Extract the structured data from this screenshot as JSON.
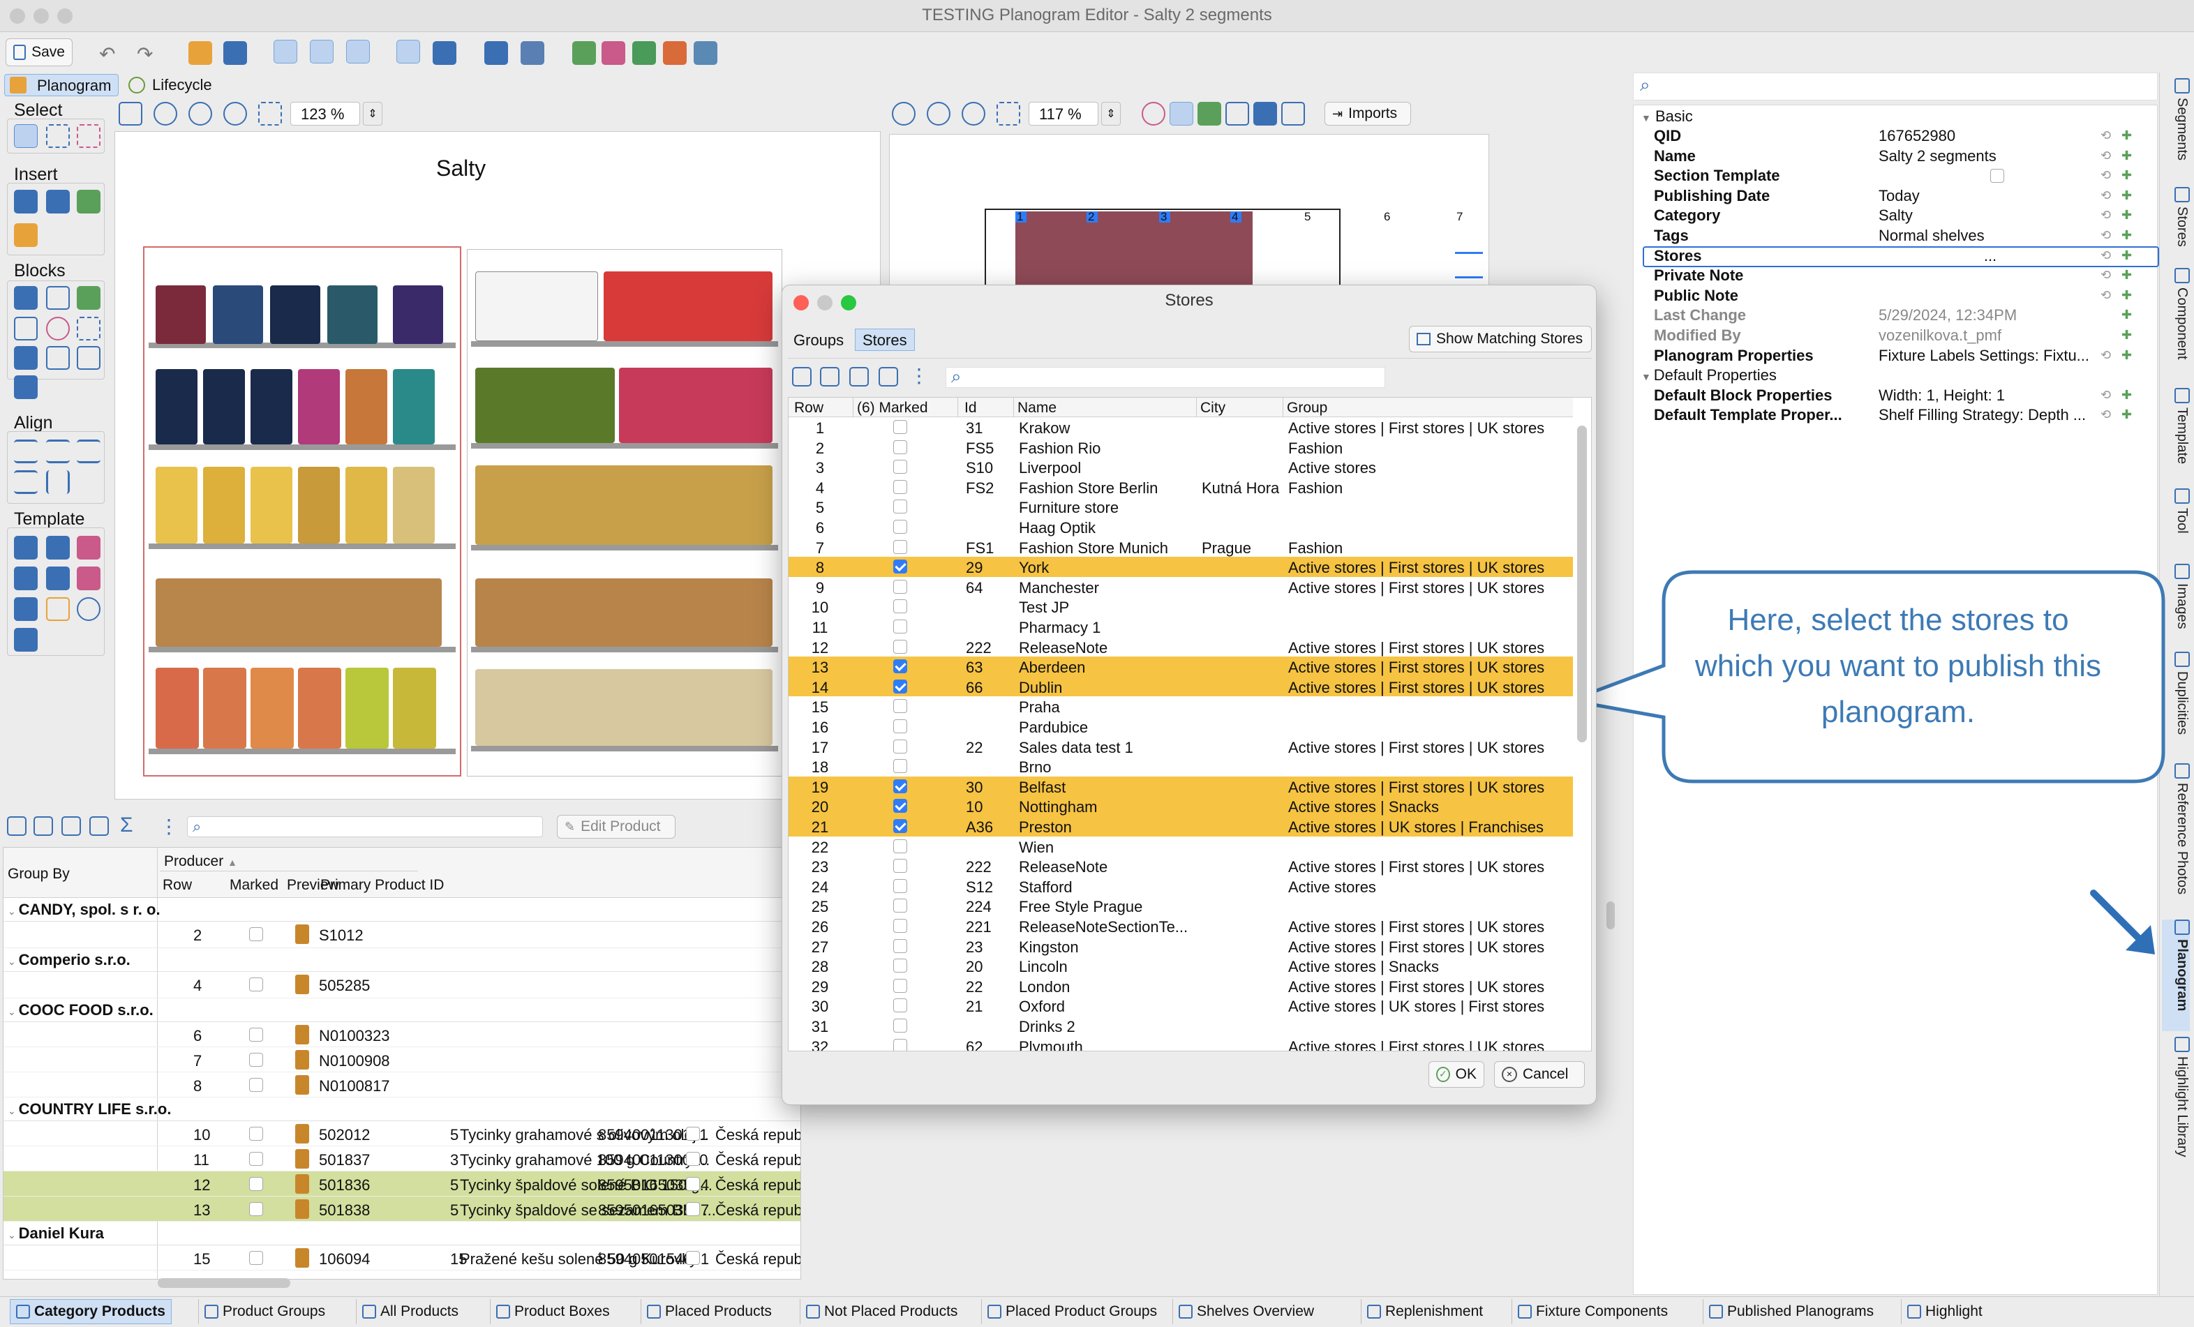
{
  "app": {
    "title": "TESTING Planogram Editor - Salty 2 segments"
  },
  "toolbar": {
    "save": "Save"
  },
  "main_tabs": [
    "Planogram",
    "Lifecycle"
  ],
  "left_panel": {
    "select": "Select",
    "insert": "Insert",
    "blocks": "Blocks",
    "align": "Align",
    "template": "Template"
  },
  "view1": {
    "zoom": "123 %",
    "planogram_title": "Salty"
  },
  "view2": {
    "zoom": "117 %",
    "imports": "Imports",
    "segments": [
      "1",
      "2",
      "3",
      "4",
      "5",
      "6",
      "7"
    ]
  },
  "search": {
    "placeholder": ""
  },
  "product_toolbar": {
    "edit_product": "Edit Product"
  },
  "product_table": {
    "group_by": "Group By",
    "producer": "Producer",
    "columns": [
      "Row",
      "Marked",
      "Preview",
      "Primary Product ID"
    ],
    "groups": [
      {
        "name": "CANDY, spol. s r. o.",
        "rows": [
          {
            "row": "2",
            "id": "S1012"
          }
        ]
      },
      {
        "name": "Comperio s.r.o.",
        "rows": [
          {
            "row": "4",
            "id": "505285"
          }
        ]
      },
      {
        "name": "COOC FOOD s.r.o.",
        "rows": [
          {
            "row": "6",
            "id": "N0100323"
          },
          {
            "row": "7",
            "id": "N0100908"
          },
          {
            "row": "8",
            "id": "N0100817"
          }
        ]
      },
      {
        "name": "COUNTRY LIFE s.r.o.",
        "rows": [
          {
            "row": "10",
            "id": "502012",
            "qty": "5",
            "name": "Tycinky grahamové s olivovým olej...",
            "ean": "8594001130191",
            "country": "Česká republika"
          },
          {
            "row": "11",
            "id": "501837",
            "qty": "3",
            "name": "Tycinky grahamové 100 g Country ...",
            "ean": "8594001130030",
            "country": "Česká republika"
          },
          {
            "row": "12",
            "id": "501836",
            "qty": "5",
            "name": "Tycinky špaldové solené BIO 150 g...",
            "ean": "8595016503574",
            "country": "Česká republika"
          },
          {
            "row": "13",
            "id": "501838",
            "qty": "5",
            "name": "Tycinky špaldové se sezamem BIO ...",
            "ean": "8595016503567",
            "country": "Česká republika"
          }
        ]
      },
      {
        "name": "Daniel Kura",
        "rows": [
          {
            "row": "15",
            "id": "106094",
            "qty": "15",
            "name": "Pražené kešu solené 50 g Kurovky",
            "ean": "8594050154001",
            "country": "Česká republika"
          }
        ]
      }
    ]
  },
  "dialog": {
    "title": "Stores",
    "tabs": [
      "Groups",
      "Stores"
    ],
    "show_matching": "Show Matching Stores",
    "columns": {
      "row": "Row",
      "marked": "(6) Marked",
      "id": "Id",
      "name": "Name",
      "city": "City",
      "group": "Group"
    },
    "rows": [
      {
        "row": "1",
        "id": "31",
        "name": "Krakow",
        "city": "",
        "group": "Active stores | First stores | UK stores",
        "m": false
      },
      {
        "row": "2",
        "id": "FS5",
        "name": "Fashion Rio",
        "city": "",
        "group": "Fashion",
        "m": false
      },
      {
        "row": "3",
        "id": "S10",
        "name": "Liverpool",
        "city": "",
        "group": "Active stores",
        "m": false
      },
      {
        "row": "4",
        "id": "FS2",
        "name": "Fashion Store Berlin",
        "city": "Kutná Hora",
        "group": "Fashion",
        "m": false
      },
      {
        "row": "5",
        "id": "",
        "name": "Furniture store",
        "city": "",
        "group": "",
        "m": false
      },
      {
        "row": "6",
        "id": "",
        "name": "Haag Optik",
        "city": "",
        "group": "",
        "m": false
      },
      {
        "row": "7",
        "id": "FS1",
        "name": "Fashion Store Munich",
        "city": "Prague",
        "group": "Fashion",
        "m": false
      },
      {
        "row": "8",
        "id": "29",
        "name": "York",
        "city": "",
        "group": "Active stores | First stores | UK stores",
        "m": true
      },
      {
        "row": "9",
        "id": "64",
        "name": "Manchester",
        "city": "",
        "group": "Active stores | First stores | UK stores",
        "m": false
      },
      {
        "row": "10",
        "id": "",
        "name": "Test JP",
        "city": "",
        "group": "",
        "m": false
      },
      {
        "row": "11",
        "id": "",
        "name": "Pharmacy 1",
        "city": "",
        "group": "",
        "m": false
      },
      {
        "row": "12",
        "id": "222",
        "name": "ReleaseNote",
        "city": "",
        "group": "Active stores | First stores | UK stores",
        "m": false
      },
      {
        "row": "13",
        "id": "63",
        "name": "Aberdeen",
        "city": "",
        "group": "Active stores | First stores | UK stores",
        "m": true
      },
      {
        "row": "14",
        "id": "66",
        "name": "Dublin",
        "city": "",
        "group": "Active stores | First stores | UK stores",
        "m": true
      },
      {
        "row": "15",
        "id": "",
        "name": "Praha",
        "city": "",
        "group": "",
        "m": false
      },
      {
        "row": "16",
        "id": "",
        "name": "Pardubice",
        "city": "",
        "group": "",
        "m": false
      },
      {
        "row": "17",
        "id": "22",
        "name": "Sales data test 1",
        "city": "",
        "group": "Active stores | First stores | UK stores",
        "m": false
      },
      {
        "row": "18",
        "id": "",
        "name": "Brno",
        "city": "",
        "group": "",
        "m": false
      },
      {
        "row": "19",
        "id": "30",
        "name": "Belfast",
        "city": "",
        "group": "Active stores | First stores | UK stores",
        "m": true
      },
      {
        "row": "20",
        "id": "10",
        "name": "Nottingham",
        "city": "",
        "group": "Active stores | Snacks",
        "m": true
      },
      {
        "row": "21",
        "id": "A36",
        "name": "Preston",
        "city": "",
        "group": "Active stores | UK stores | Franchises",
        "m": true
      },
      {
        "row": "22",
        "id": "",
        "name": "Wien",
        "city": "",
        "group": "",
        "m": false
      },
      {
        "row": "23",
        "id": "222",
        "name": "ReleaseNote",
        "city": "",
        "group": "Active stores | First stores | UK stores",
        "m": false
      },
      {
        "row": "24",
        "id": "S12",
        "name": "Stafford",
        "city": "",
        "group": "Active stores",
        "m": false
      },
      {
        "row": "25",
        "id": "224",
        "name": "Free Style Prague",
        "city": "",
        "group": "",
        "m": false
      },
      {
        "row": "26",
        "id": "221",
        "name": "ReleaseNoteSectionTe...",
        "city": "",
        "group": "Active stores | First stores | UK stores",
        "m": false
      },
      {
        "row": "27",
        "id": "23",
        "name": "Kingston",
        "city": "",
        "group": "Active stores | First stores | UK stores",
        "m": false
      },
      {
        "row": "28",
        "id": "20",
        "name": "Lincoln",
        "city": "",
        "group": "Active stores | Snacks",
        "m": false
      },
      {
        "row": "29",
        "id": "22",
        "name": "London",
        "city": "",
        "group": "Active stores | First stores | UK stores",
        "m": false
      },
      {
        "row": "30",
        "id": "21",
        "name": "Oxford",
        "city": "",
        "group": "Active stores | UK stores | First stores",
        "m": false
      },
      {
        "row": "31",
        "id": "",
        "name": "Drinks 2",
        "city": "",
        "group": "",
        "m": false
      },
      {
        "row": "32",
        "id": "62",
        "name": "Plymouth",
        "city": "",
        "group": "Active stores | First stores | UK stores",
        "m": false
      }
    ],
    "ok": "OK",
    "cancel": "Cancel"
  },
  "callout": {
    "text": "Here, select the stores to which you want to publish this planogram."
  },
  "properties": {
    "basic": "Basic",
    "items": [
      {
        "k": "QID",
        "v": "167652980",
        "dim": false
      },
      {
        "k": "Name",
        "v": "Salty 2 segments",
        "dim": false
      },
      {
        "k": "Section Template",
        "v": "",
        "dim": false
      },
      {
        "k": "Publishing Date",
        "v": "Today",
        "dim": false
      },
      {
        "k": "Category",
        "v": "Salty",
        "dim": false
      },
      {
        "k": "Tags",
        "v": "Normal shelves",
        "dim": false
      },
      {
        "k": "Stores",
        "v": "...",
        "dim": false
      },
      {
        "k": "Private Note",
        "v": "",
        "dim": false
      },
      {
        "k": "Public Note",
        "v": "",
        "dim": false
      },
      {
        "k": "Last Change",
        "v": "5/29/2024, 12:34PM",
        "dim": true
      },
      {
        "k": "Modified By",
        "v": "vozenilkova.t_pmf",
        "dim": true
      },
      {
        "k": "Planogram Properties",
        "v": "Fixture Labels Settings: Fixtu...",
        "dim": false
      }
    ],
    "default": "Default Properties",
    "default_items": [
      {
        "k": "Default Block Properties",
        "v": "Width: 1, Height: 1"
      },
      {
        "k": "Default Template Proper...",
        "v": "Shelf Filling Strategy: Depth ..."
      }
    ]
  },
  "side_tabs": [
    "Segments",
    "Stores",
    "Component",
    "Template",
    "Tool",
    "Images",
    "Duplicities",
    "Reference Photos",
    "Planogram",
    "Highlight Library"
  ],
  "bottom_tabs": [
    "Category Products",
    "Product Groups",
    "All Products",
    "Product Boxes",
    "Placed Products",
    "Not Placed Products",
    "Placed Product Groups",
    "Shelves Overview",
    "Replenishment",
    "Fixture Components",
    "Published Planograms",
    "Highlight"
  ],
  "colors": {
    "accent": "#2f7cf6",
    "highlight": "#f6c342",
    "green_row": "#d3df9e",
    "callout": "#3d7ab5"
  }
}
